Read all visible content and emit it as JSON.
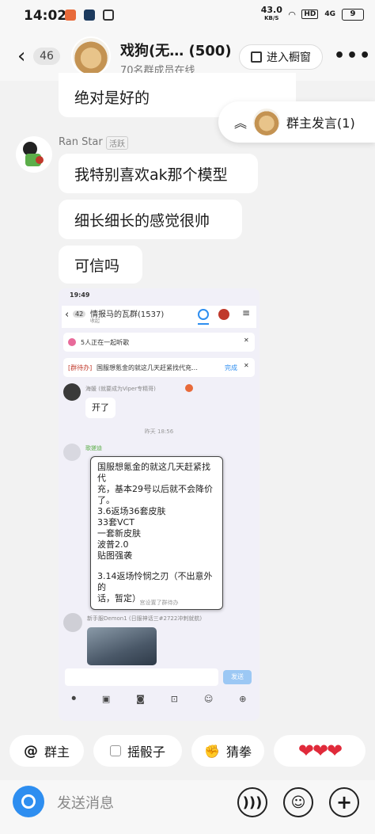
{
  "status_bar": {
    "time": "14:02",
    "net_speed": "43.0",
    "net_unit": "KB/S",
    "hd": "HD",
    "signal": "4G",
    "battery": "9"
  },
  "header": {
    "unread": "46",
    "group_name": "戏狗(无…",
    "member_count": "(500)",
    "online": "70名群成员在线",
    "shop_button": "进入橱窗",
    "more": "•••"
  },
  "chat": {
    "partial_top": "绝对是好的",
    "floating": {
      "label": "群主发言(1)"
    },
    "sender": {
      "name": "Ran Star",
      "tag": "活跃"
    },
    "messages": [
      "我特别喜欢ak那个模型",
      "细长细长的感觉很帅",
      "可信吗"
    ]
  },
  "embedded": {
    "time": "19:49",
    "back_count": "42",
    "title": "情报马的瓦群(1537)",
    "subtitle": "收起",
    "listening": "5人正在一起听歌",
    "todo_tag": "[群待办]",
    "todo_text": "国服想氪金的就这几天赶紧找代充…",
    "todo_done": "完成",
    "user1": "海媛 (就要成为Viper专精哥)",
    "msg1": "开了",
    "time_divider": "昨天 18:56",
    "user2": "歌搓迪",
    "long_msg": [
      "国服想氪金的就这几天赶紧找代",
      "充，基本29号以后就不会降价",
      "了。",
      "3.6返场36套皮肤",
      "33套VCT",
      "一套新皮肤",
      "波普2.0",
      "贴图强袭",
      "",
      "3.14返场怜悯之刃（不出意外的",
      "话，暂定）"
    ],
    "system_msg": "宫设置了群待办",
    "user3": "新手服Demon1 (日服神话三#2722冲刺就航)",
    "send_btn": "发送"
  },
  "quick_actions": {
    "at_owner": "群主",
    "dice": "摇骰子",
    "rps": "猜拳",
    "hearts": "❤❤❤"
  },
  "input": {
    "placeholder": "发送消息"
  }
}
